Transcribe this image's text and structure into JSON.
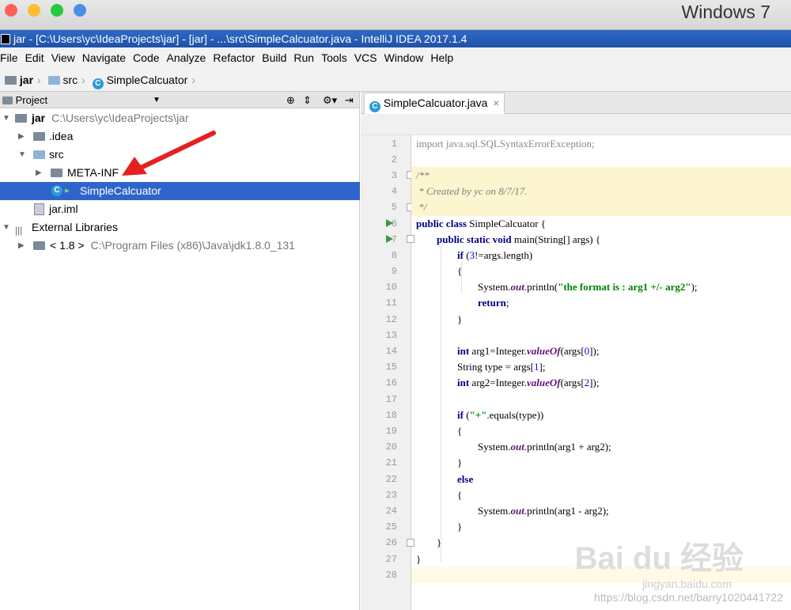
{
  "mac": {
    "title": "Windows 7",
    "dots": [
      "#ff5f57",
      "#febc2e",
      "#28c840",
      "#4a90e2"
    ]
  },
  "window": {
    "title": "jar - [C:\\Users\\yc\\IdeaProjects\\jar] - [jar] - ...\\src\\SimpleCalcuator.java - IntelliJ IDEA 2017.1.4"
  },
  "menu": [
    "File",
    "Edit",
    "View",
    "Navigate",
    "Code",
    "Analyze",
    "Refactor",
    "Build",
    "Run",
    "Tools",
    "VCS",
    "Window",
    "Help"
  ],
  "breadcrumb": [
    "jar",
    "src",
    "SimpleCalcuator"
  ],
  "project_panel": {
    "title": "Project",
    "icons": [
      "crosshair-icon",
      "collapse-icon",
      "gear-icon",
      "hide-icon"
    ]
  },
  "tree": [
    {
      "label": "jar",
      "path": "C:\\Users\\yc\\IdeaProjects\\jar",
      "bold": true
    },
    {
      "label": ".idea"
    },
    {
      "label": "src"
    },
    {
      "label": "META-INF"
    },
    {
      "label": "SimpleCalcuator",
      "selected": true
    },
    {
      "label": "jar.iml"
    },
    {
      "label": "External Libraries"
    },
    {
      "label": "< 1.8 >",
      "path": "C:\\Program Files (x86)\\Java\\jdk1.8.0_131"
    }
  ],
  "editor": {
    "tab": "SimpleCalcuator.java",
    "current_line": "28"
  },
  "code_lines": [
    "1",
    "2",
    "3",
    "4",
    "5",
    "6",
    "7",
    "8",
    "9",
    "10",
    "11",
    "12",
    "13",
    "14",
    "15",
    "16",
    "17",
    "18",
    "19",
    "20",
    "21",
    "22",
    "23",
    "24",
    "25",
    "26",
    "27",
    "28"
  ],
  "code": {
    "l1": "import java.sql.SQLSyntaxErrorException;",
    "l3": "/**",
    "l4": " * Created by yc on 8/7/17.",
    "l5": " */",
    "l6a": "public class",
    "l6b": " SimpleCalcuator {",
    "l7a": "public static void",
    "l7b": " main(String[] args) {",
    "l8a": "if",
    "l8b": " (",
    "l8c": "3",
    "l8d": "!=args.length)",
    "l9": "{",
    "l10a": "System.",
    "l10b": "out",
    "l10c": ".println(",
    "l10d": "\"the format is : arg1 +/- arg2\"",
    "l10e": ");",
    "l11": "return",
    "l11b": ";",
    "l12": "}",
    "l14a": "int",
    "l14b": " arg1=Integer.",
    "l14c": "valueOf",
    "l14d": "(args[",
    "l14e": "0",
    "l14f": "]);",
    "l15a": "String type = args[",
    "l15b": "1",
    "l15c": "];",
    "l16a": "int",
    "l16b": " arg2=Integer.",
    "l16c": "valueOf",
    "l16d": "(args[",
    "l16e": "2",
    "l16f": "]);",
    "l18a": "if",
    "l18b": " (",
    "l18c": "\"+\"",
    "l18d": ".equals(type))",
    "l19": "{",
    "l20a": "System.",
    "l20b": "out",
    "l20c": ".println(arg1 + arg2);",
    "l21": "}",
    "l22": "else",
    "l23": "{",
    "l24a": "System.",
    "l24b": "out",
    "l24c": ".println(arg1 - arg2);",
    "l25": "}",
    "l26": "}",
    "l27": "}"
  },
  "watermark": {
    "logo": "Bai du 经验",
    "site": "jingyan.baidu.com",
    "url": "https://blog.csdn.net/barry1020441722"
  }
}
